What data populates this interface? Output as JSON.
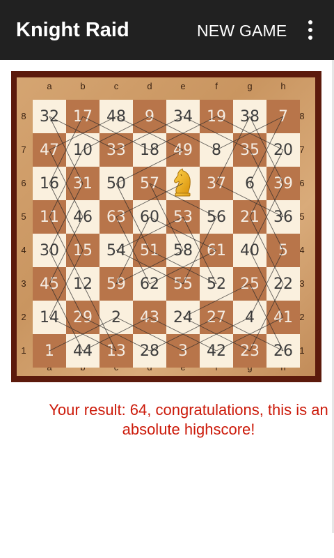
{
  "app": {
    "title": "Knight Raid",
    "new_game_label": "NEW GAME",
    "menu_icon": "overflow-menu-icon"
  },
  "board": {
    "files": [
      "a",
      "b",
      "c",
      "d",
      "e",
      "f",
      "g",
      "h"
    ],
    "ranks": [
      "8",
      "7",
      "6",
      "5",
      "4",
      "3",
      "2",
      "1"
    ],
    "cells": [
      [
        "32",
        "17",
        "48",
        "9",
        "34",
        "19",
        "38",
        "7"
      ],
      [
        "47",
        "10",
        "33",
        "18",
        "49",
        "8",
        "35",
        "20"
      ],
      [
        "16",
        "31",
        "50",
        "57",
        "",
        "37",
        "6",
        "39"
      ],
      [
        "11",
        "46",
        "63",
        "60",
        "53",
        "56",
        "21",
        "36"
      ],
      [
        "30",
        "15",
        "54",
        "51",
        "58",
        "61",
        "40",
        "5"
      ],
      [
        "45",
        "12",
        "59",
        "62",
        "55",
        "52",
        "25",
        "22"
      ],
      [
        "14",
        "29",
        "2",
        "43",
        "24",
        "27",
        "4",
        "41"
      ],
      [
        "1",
        "44",
        "13",
        "28",
        "3",
        "42",
        "23",
        "26"
      ]
    ],
    "knight_square": "e6",
    "knight_icon": "knight-icon",
    "colors": {
      "light": "#faf0de",
      "dark": "#b8754a",
      "frame": "#5c1a0c"
    }
  },
  "result": {
    "text": "Your result: 64, congratulations, this is an absolute highscore!",
    "color": "#cc1a0a"
  }
}
